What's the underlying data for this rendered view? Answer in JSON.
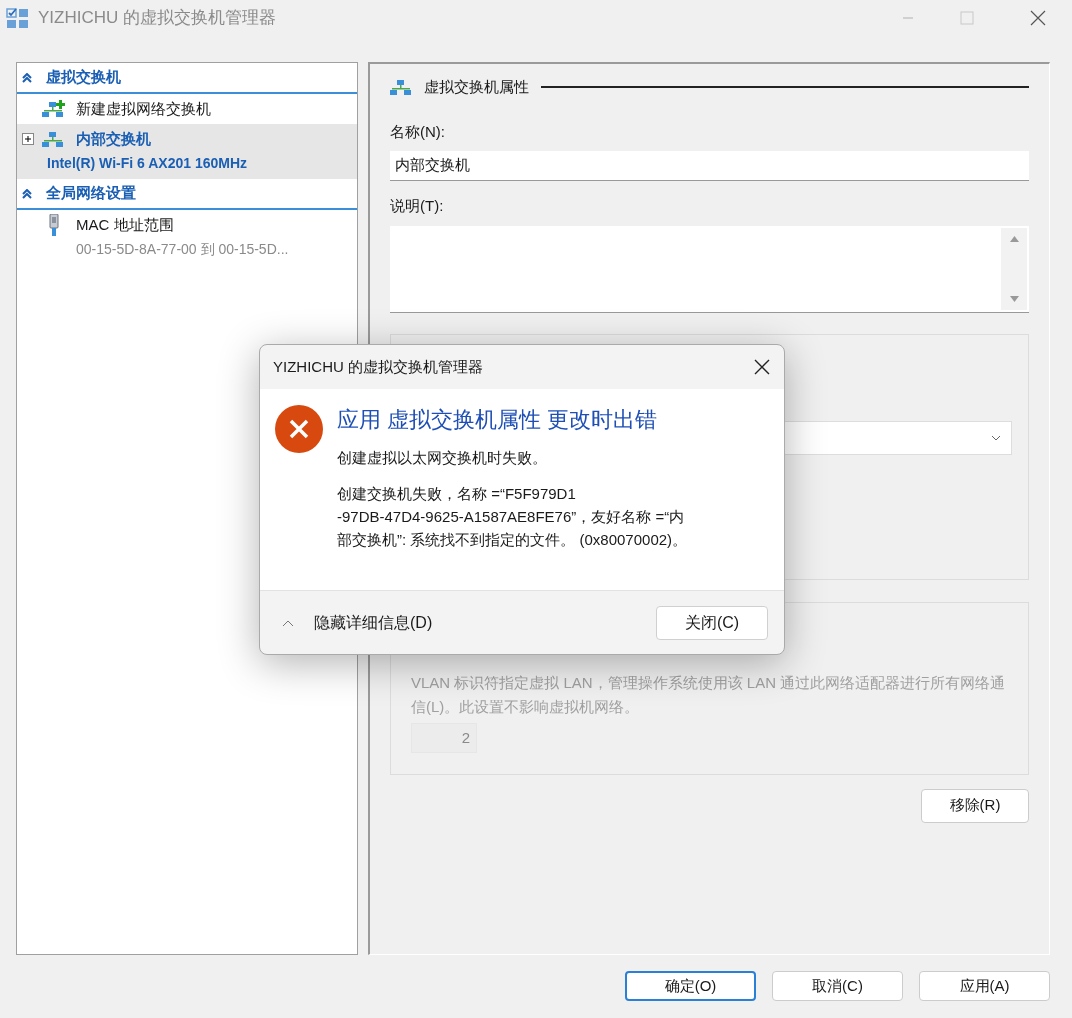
{
  "window": {
    "title": "YIZHICHU 的虚拟交换机管理器"
  },
  "sidebar": {
    "sections": [
      {
        "title": "虚拟交换机",
        "expanded": true,
        "items": [
          {
            "kind": "new",
            "label": "新建虚拟网络交换机",
            "selected": false
          },
          {
            "kind": "switch",
            "label": "内部交换机",
            "detail": "Intel(R) Wi-Fi 6 AX201 160MHz",
            "selected": true
          }
        ]
      },
      {
        "title": "全局网络设置",
        "expanded": true,
        "items": [
          {
            "kind": "mac",
            "label": "MAC 地址范围",
            "detail": "00-15-5D-8A-77-00 到 00-15-5D...",
            "selected": false
          }
        ]
      }
    ]
  },
  "properties": {
    "title": "虚拟交换机属性",
    "name_label": "名称(N):",
    "name_value": "内部交换机",
    "description_label": "说明(T):",
    "vlan_text": "VLAN 标识符指定虚拟 LAN，管理操作系统使用该 LAN 通过此网络适配器进行所有网络通信(L)。此设置不影响虚拟机网络。",
    "vlan_id": "2",
    "remove_button": "移除(R)"
  },
  "dialog": {
    "title": "YIZHICHU 的虚拟交换机管理器",
    "heading": "应用 虚拟交换机属性 更改时出错",
    "message": "创建虚拟以太网交换机时失败。",
    "details": "创建交换机失败，名称 =“F5F979D1\n-97DB-47D4-9625-A1587AE8FE76”，友好名称 =“内部交换机”: 系统找不到指定的文件。 (0x80070002)。",
    "toggle": "隐藏详细信息(D)",
    "close_button": "关闭(C)"
  },
  "buttons": [
    {
      "label": "确定(O)",
      "default": true
    },
    {
      "label": "取消(C)",
      "default": false
    },
    {
      "label": "应用(A)",
      "default": false
    }
  ]
}
